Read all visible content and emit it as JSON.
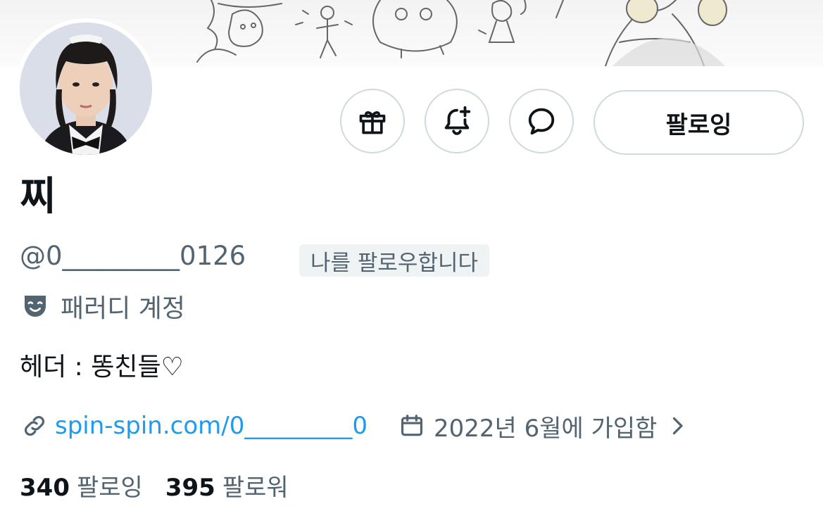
{
  "profile": {
    "display_name": "찌",
    "handle": "@0_________0126",
    "follows_you_badge": "나를 팔로우합니다",
    "account_label": "패러디 계정",
    "bio": "헤더 : 똥친들♡",
    "link": "spin-spin.com/0_________0",
    "joined": "2022년 6월에 가입함"
  },
  "actions": {
    "follow_label": "팔로잉",
    "icons": [
      "gift-icon",
      "notification-bell-plus-icon",
      "message-icon"
    ]
  },
  "stats": {
    "following_count": "340",
    "following_label": "팔로잉",
    "followers_count": "395",
    "followers_label": "팔로워"
  },
  "colors": {
    "link": "#1d9bf0",
    "secondary_text": "#536471",
    "border": "#cfd9de",
    "badge_bg": "#eff3f4"
  }
}
